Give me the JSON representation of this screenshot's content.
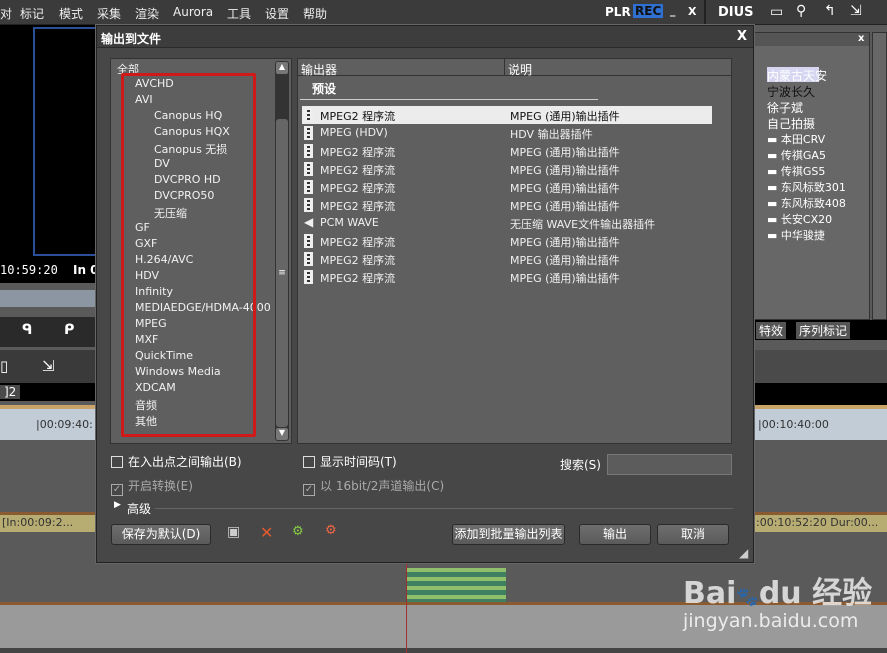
{
  "menubar": {
    "items": [
      "对",
      "标记",
      "模式",
      "采集",
      "渲染",
      "Aurora",
      "工具",
      "设置",
      "帮助"
    ],
    "plr": "PLR",
    "rec": "REC",
    "minimize": "_",
    "close": "X",
    "app_fragment": "DIUS"
  },
  "preview": {
    "timecode": "10:59:20",
    "in_label": "In 0"
  },
  "timeline": {
    "tab_fragment": "]2",
    "ruler_left": "|00:09:40:",
    "ruler_right": "|00:10:40:00",
    "clip_left": "[In:00:09:2...",
    "clip_right": ":00:10:52:20 Dur:00..."
  },
  "bin_panel": {
    "close": "x",
    "items": [
      "内蒙古天安",
      "宁波长久",
      "徐子斌",
      "自己拍摄"
    ],
    "sub_items": [
      "本田CRV",
      "传祺GA5",
      "传祺GS5",
      "东风标致301",
      "东风标致408",
      "长安CX20",
      "中华骏捷"
    ],
    "selected": "宁波长久",
    "tabs": [
      "特效",
      "序列标记"
    ]
  },
  "dialog": {
    "title": "输出到文件",
    "close": "X",
    "tree": {
      "root": "全部",
      "items": [
        {
          "label": "AVCHD",
          "level": 1
        },
        {
          "label": "AVI",
          "level": 1
        },
        {
          "label": "Canopus HQ",
          "level": 2
        },
        {
          "label": "Canopus HQX",
          "level": 2
        },
        {
          "label": "Canopus 无损",
          "level": 2
        },
        {
          "label": "DV",
          "level": 2
        },
        {
          "label": "DVCPRO HD",
          "level": 2
        },
        {
          "label": "DVCPRO50",
          "level": 2
        },
        {
          "label": "无压缩",
          "level": 2
        },
        {
          "label": "GF",
          "level": 1
        },
        {
          "label": "GXF",
          "level": 1
        },
        {
          "label": "H.264/AVC",
          "level": 1
        },
        {
          "label": "HDV",
          "level": 1
        },
        {
          "label": "Infinity",
          "level": 1
        },
        {
          "label": "MEDIAEDGE/HDMA-4000",
          "level": 1
        },
        {
          "label": "MPEG",
          "level": 1
        },
        {
          "label": "MXF",
          "level": 1
        },
        {
          "label": "QuickTime",
          "level": 1
        },
        {
          "label": "Windows Media",
          "level": 1
        },
        {
          "label": "XDCAM",
          "level": 1
        },
        {
          "label": "音频",
          "level": 1
        },
        {
          "label": "其他",
          "level": 1
        }
      ]
    },
    "list": {
      "columns": [
        "输出器",
        "说明"
      ],
      "group": "预设",
      "rows": [
        {
          "name": "MPEG2 程序流",
          "desc": "MPEG (通用)输出插件",
          "icon": "film-icon",
          "selected": true
        },
        {
          "name": "MPEG (HDV)",
          "desc": "HDV 输出器插件",
          "icon": "film-icon"
        },
        {
          "name": "MPEG2 程序流",
          "desc": "MPEG (通用)输出插件",
          "icon": "film-icon"
        },
        {
          "name": "MPEG2 程序流",
          "desc": "MPEG (通用)输出插件",
          "icon": "film-icon"
        },
        {
          "name": "MPEG2 程序流",
          "desc": "MPEG (通用)输出插件",
          "icon": "film-icon"
        },
        {
          "name": "MPEG2 程序流",
          "desc": "MPEG (通用)输出插件",
          "icon": "film-icon"
        },
        {
          "name": "PCM WAVE",
          "desc": "无压缩 WAVE文件输出器插件",
          "icon": "speaker-icon"
        },
        {
          "name": "MPEG2 程序流",
          "desc": "MPEG (通用)输出插件",
          "icon": "film-icon"
        },
        {
          "name": "MPEG2 程序流",
          "desc": "MPEG (通用)输出插件",
          "icon": "film-icon"
        },
        {
          "name": "MPEG2 程序流",
          "desc": "MPEG (通用)输出插件",
          "icon": "film-icon"
        }
      ]
    },
    "options": {
      "between_in_out": {
        "label": "在入出点之间输出(B)",
        "checked": false
      },
      "enable_convert": {
        "label": "开启转换(E)",
        "checked": true,
        "disabled": true
      },
      "show_timecode": {
        "label": "显示时间码(T)",
        "checked": false
      },
      "output_16bit": {
        "label": "以 16bit/2声道输出(C)",
        "checked": true,
        "disabled": true
      },
      "search_label": "搜索(S)",
      "search_value": ""
    },
    "advanced": "高级",
    "buttons": {
      "save_default": "保存为默认(D)",
      "add_batch": "添加到批量输出列表",
      "export": "输出",
      "cancel": "取消"
    }
  },
  "watermark": {
    "brand": "Baidu经验",
    "url": "jingyan.baidu.com"
  },
  "colors": {
    "highlight_box": "#d01a1a",
    "rec_badge": "#2f6fd0"
  }
}
